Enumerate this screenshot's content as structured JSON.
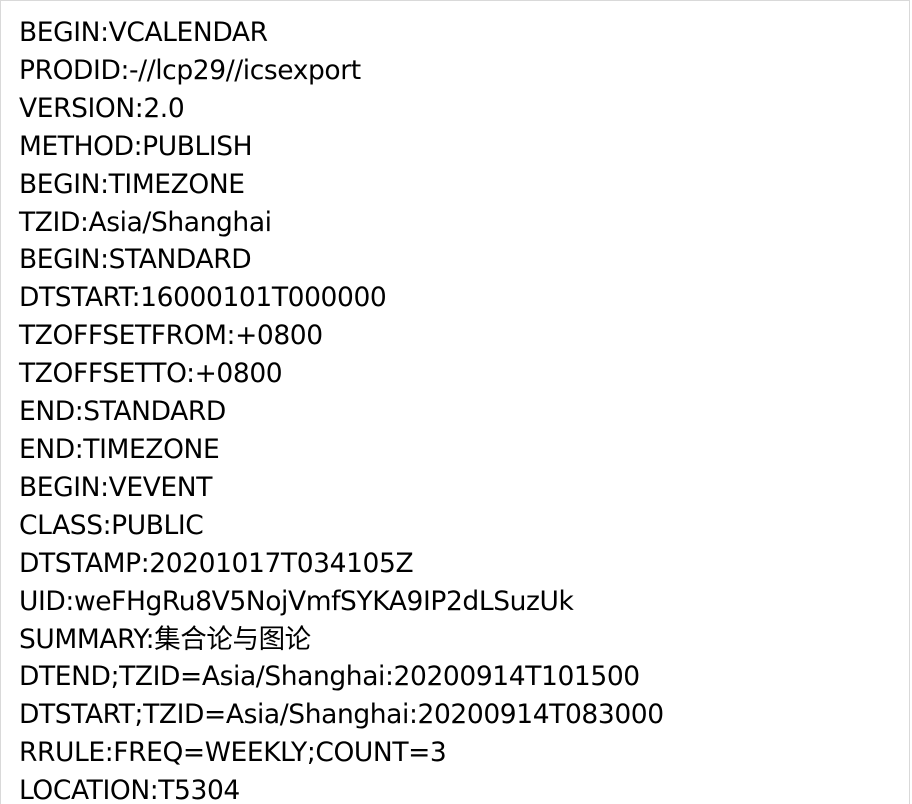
{
  "document": {
    "lines": [
      "BEGIN:VCALENDAR",
      "PRODID:-//lcp29//icsexport",
      "VERSION:2.0",
      "METHOD:PUBLISH",
      "BEGIN:TIMEZONE",
      "TZID:Asia/Shanghai",
      "BEGIN:STANDARD",
      "DTSTART:16000101T000000",
      "TZOFFSETFROM:+0800",
      "TZOFFSETTO:+0800",
      "END:STANDARD",
      "END:TIMEZONE",
      "BEGIN:VEVENT",
      "CLASS:PUBLIC",
      "DTSTAMP:20201017T034105Z",
      "UID:weFHgRu8V5NojVmfSYKA9IP2dLSuzUk",
      "SUMMARY:集合论与图论",
      "DTEND;TZID=Asia/Shanghai:20200914T101500",
      "DTSTART;TZID=Asia/Shanghai:20200914T083000",
      "RRULE:FREQ=WEEKLY;COUNT=3",
      "LOCATION:T5304"
    ]
  }
}
